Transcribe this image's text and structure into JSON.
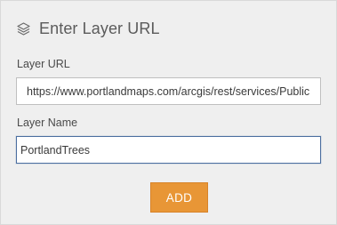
{
  "header": {
    "icon": "layers-icon",
    "title": "Enter Layer URL"
  },
  "form": {
    "url_label": "Layer URL",
    "url_value": "https://www.portlandmaps.com/arcgis/rest/services/Public",
    "name_label": "Layer Name",
    "name_value": "PortlandTrees",
    "add_label": "ADD"
  },
  "colors": {
    "panel_bg": "#efefef",
    "accent": "#e89636",
    "focus_border": "#4c6fa0"
  }
}
